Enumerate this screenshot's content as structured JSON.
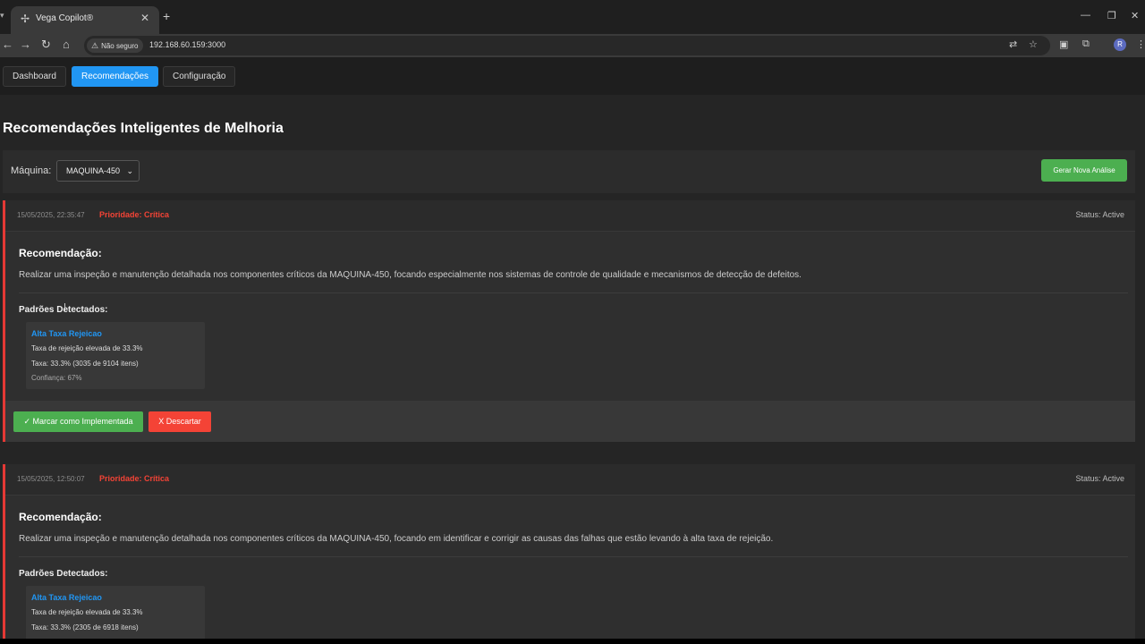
{
  "browser": {
    "tab_title": "Vega Copilot®",
    "security_label": "Não seguro",
    "url": "192.168.60.159:3000",
    "profile_initial": "R"
  },
  "nav": {
    "dashboard": "Dashboard",
    "recomendacoes": "Recomendações",
    "configuracao": "Configuração"
  },
  "page": {
    "title": "Recomendações Inteligentes de Melhoria",
    "machine_label": "Máquina:",
    "machine_selected": "MAQUINA-450",
    "generate_button": "Gerar Nova Análise"
  },
  "cards": [
    {
      "timestamp": "15/05/2025, 22:35:47",
      "priority": "Prioridade: Crítica",
      "status": "Status: Active",
      "rec_heading": "Recomendação:",
      "rec_text": "Realizar uma inspeção e manutenção detalhada nos componentes críticos da MAQUINA-450, focando especialmente nos sistemas de controle de qualidade e mecanismos de detecção de defeitos.",
      "patterns_heading": "Padrões Detectados:",
      "pattern": {
        "name": "Alta Taxa Rejeicao",
        "desc": "Taxa de rejeição elevada de 33.3%",
        "rate": "Taxa: 33.3% (3035 de 9104 itens)",
        "confidence": "Confiança: 67%"
      },
      "implement_button": "✓ Marcar como Implementada",
      "discard_button": "X Descartar"
    },
    {
      "timestamp": "15/05/2025, 12:50:07",
      "priority": "Prioridade: Crítica",
      "status": "Status: Active",
      "rec_heading": "Recomendação:",
      "rec_text": "Realizar uma inspeção e manutenção detalhada nos componentes críticos da MAQUINA-450, focando em identificar e corrigir as causas das falhas que estão levando à alta taxa de rejeição.",
      "patterns_heading": "Padrões Detectados:",
      "pattern": {
        "name": "Alta Taxa Rejeicao",
        "desc": "Taxa de rejeição elevada de 33.3%",
        "rate": "Taxa: 33.3% (2305 de 6918 itens)"
      }
    }
  ],
  "colors": {
    "accent": "#2196f3",
    "success": "#4caf50",
    "danger": "#f44336"
  }
}
